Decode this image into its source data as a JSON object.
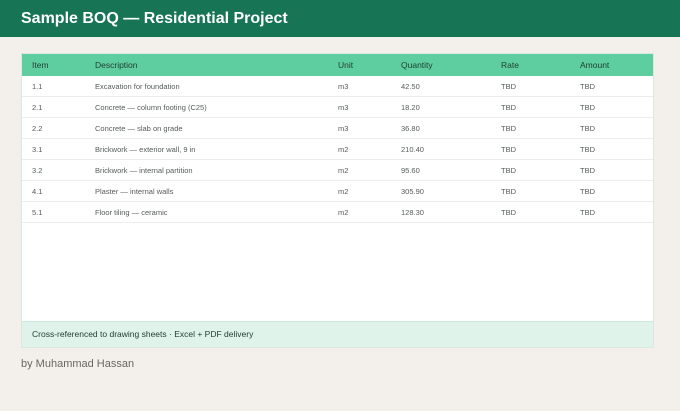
{
  "header": {
    "title": "Sample BOQ — Residential Project"
  },
  "table": {
    "columns": [
      "Item",
      "Description",
      "Unit",
      "Quantity",
      "Rate",
      "Amount"
    ],
    "rows": [
      [
        "1.1",
        "Excavation for foundation",
        "m3",
        "42.50",
        "TBD",
        "TBD"
      ],
      [
        "2.1",
        "Concrete — column footing (C25)",
        "m3",
        "18.20",
        "TBD",
        "TBD"
      ],
      [
        "2.2",
        "Concrete — slab on grade",
        "m3",
        "36.80",
        "TBD",
        "TBD"
      ],
      [
        "3.1",
        "Brickwork — exterior wall, 9 in",
        "m2",
        "210.40",
        "TBD",
        "TBD"
      ],
      [
        "3.2",
        "Brickwork — internal partition",
        "m2",
        "95.60",
        "TBD",
        "TBD"
      ],
      [
        "4.1",
        "Plaster — internal walls",
        "m2",
        "305.90",
        "TBD",
        "TBD"
      ],
      [
        "5.1",
        "Floor tiling — ceramic",
        "m2",
        "128.30",
        "TBD",
        "TBD"
      ]
    ]
  },
  "note": "Cross-referenced to drawing sheets · Excel + PDF delivery",
  "byline": "by Muhammad Hassan",
  "colors": {
    "header": "#177454",
    "table_header": "#5ecea0",
    "note_bg": "#dff3ea"
  }
}
